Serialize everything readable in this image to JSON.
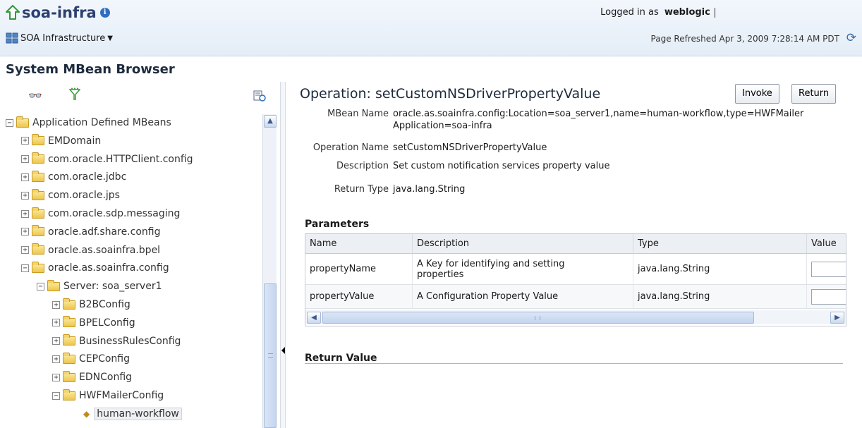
{
  "header": {
    "app_title": "soa-infra",
    "target_menu": "SOA Infrastructure",
    "logged_in_prefix": "Logged in as",
    "username": "weblogic",
    "page_refreshed": "Page Refreshed Apr 3, 2009 7:28:14 AM PDT"
  },
  "browser_title": "System MBean Browser",
  "tree": {
    "nodes": [
      {
        "label": "Application Defined MBeans",
        "state": "expanded",
        "level": 0
      },
      {
        "label": "EMDomain",
        "state": "collapsed",
        "level": 1
      },
      {
        "label": "com.oracle.HTTPClient.config",
        "state": "collapsed",
        "level": 1
      },
      {
        "label": "com.oracle.jdbc",
        "state": "collapsed",
        "level": 1
      },
      {
        "label": "com.oracle.jps",
        "state": "collapsed",
        "level": 1
      },
      {
        "label": "com.oracle.sdp.messaging",
        "state": "collapsed",
        "level": 1
      },
      {
        "label": "oracle.adf.share.config",
        "state": "collapsed",
        "level": 1
      },
      {
        "label": "oracle.as.soainfra.bpel",
        "state": "collapsed",
        "level": 1
      },
      {
        "label": "oracle.as.soainfra.config",
        "state": "expanded",
        "level": 1
      },
      {
        "label": "Server: soa_server1",
        "state": "expanded",
        "level": 2
      },
      {
        "label": "B2BConfig",
        "state": "collapsed",
        "level": 3
      },
      {
        "label": "BPELConfig",
        "state": "collapsed",
        "level": 3
      },
      {
        "label": "BusinessRulesConfig",
        "state": "collapsed",
        "level": 3
      },
      {
        "label": "CEPConfig",
        "state": "collapsed",
        "level": 3
      },
      {
        "label": "EDNConfig",
        "state": "collapsed",
        "level": 3
      },
      {
        "label": "HWFMailerConfig",
        "state": "expanded",
        "level": 3
      },
      {
        "label": "human-workflow",
        "state": "leaf",
        "level": 4,
        "selected": true
      }
    ]
  },
  "operation": {
    "title": "Operation: setCustomNSDriverPropertyValue",
    "invoke_label": "Invoke",
    "return_label": "Return",
    "mbean_name_label": "MBean Name",
    "mbean_name_line1": "oracle.as.soainfra.config:Location=soa_server1,name=human-workflow,type=HWFMailer",
    "mbean_name_line2": "Application=soa-infra",
    "operation_name_label": "Operation Name",
    "operation_name": "setCustomNSDriverPropertyValue",
    "description_label": "Description",
    "description": "Set custom notification services property value",
    "return_type_label": "Return Type",
    "return_type": "java.lang.String"
  },
  "parameters": {
    "title": "Parameters",
    "columns": [
      "Name",
      "Description",
      "Type",
      "Value"
    ],
    "rows": [
      {
        "name": "propertyName",
        "description": "A Key for identifying and setting properties",
        "type": "java.lang.String",
        "value": ""
      },
      {
        "name": "propertyValue",
        "description": "A Configuration Property Value",
        "type": "java.lang.String",
        "value": ""
      }
    ]
  },
  "return_value": {
    "title": "Return Value"
  }
}
